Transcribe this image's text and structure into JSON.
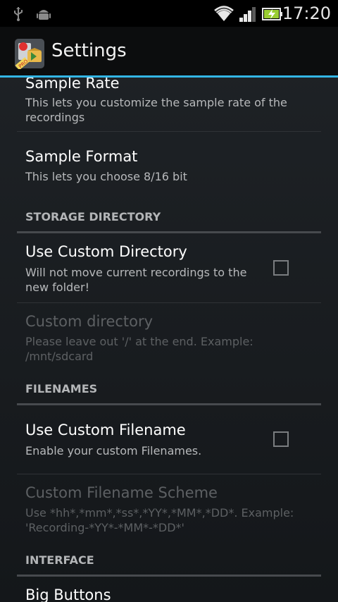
{
  "status_bar": {
    "time": "17:20",
    "icons": [
      "usb-icon",
      "android-debug-icon",
      "wifi-icon",
      "signal-icon",
      "battery-charging-icon"
    ]
  },
  "action_bar": {
    "title": "Settings",
    "app_icon": "recorder-pro-app-icon",
    "app_icon_badge": "PRO"
  },
  "preferences": {
    "sample_rate": {
      "title": "Sample Rate",
      "summary": "This lets you customize the sample rate of the recordings"
    },
    "sample_format": {
      "title": "Sample Format",
      "summary": "This lets you choose 8/16 bit"
    },
    "storage_directory": {
      "category": "STORAGE DIRECTORY",
      "use_custom_directory": {
        "title": "Use Custom Directory",
        "summary": "Will not move current recordings to the new folder!",
        "checked": false
      },
      "custom_directory": {
        "title": "Custom directory",
        "summary": "Please leave out '/' at the end. Example: /mnt/sdcard",
        "enabled": false
      }
    },
    "filenames": {
      "category": "FILENAMES",
      "use_custom_filename": {
        "title": "Use Custom Filename",
        "summary": "Enable your custom Filenames.",
        "checked": false
      },
      "custom_filename_scheme": {
        "title": "Custom Filename Scheme",
        "summary": "Use *hh*,*mm*,*ss*,*YY*,*MM*,*DD*. Example: 'Recording-*YY*-*MM*-*DD*'",
        "enabled": false
      }
    },
    "interface": {
      "category": "INTERFACE",
      "big_buttons": {
        "title": "Big Buttons"
      }
    }
  },
  "colors": {
    "accent": "#33b5e5",
    "background": "#1c1f22",
    "summary_text": "#b7b9bb",
    "disabled_text": "#5d6063"
  }
}
